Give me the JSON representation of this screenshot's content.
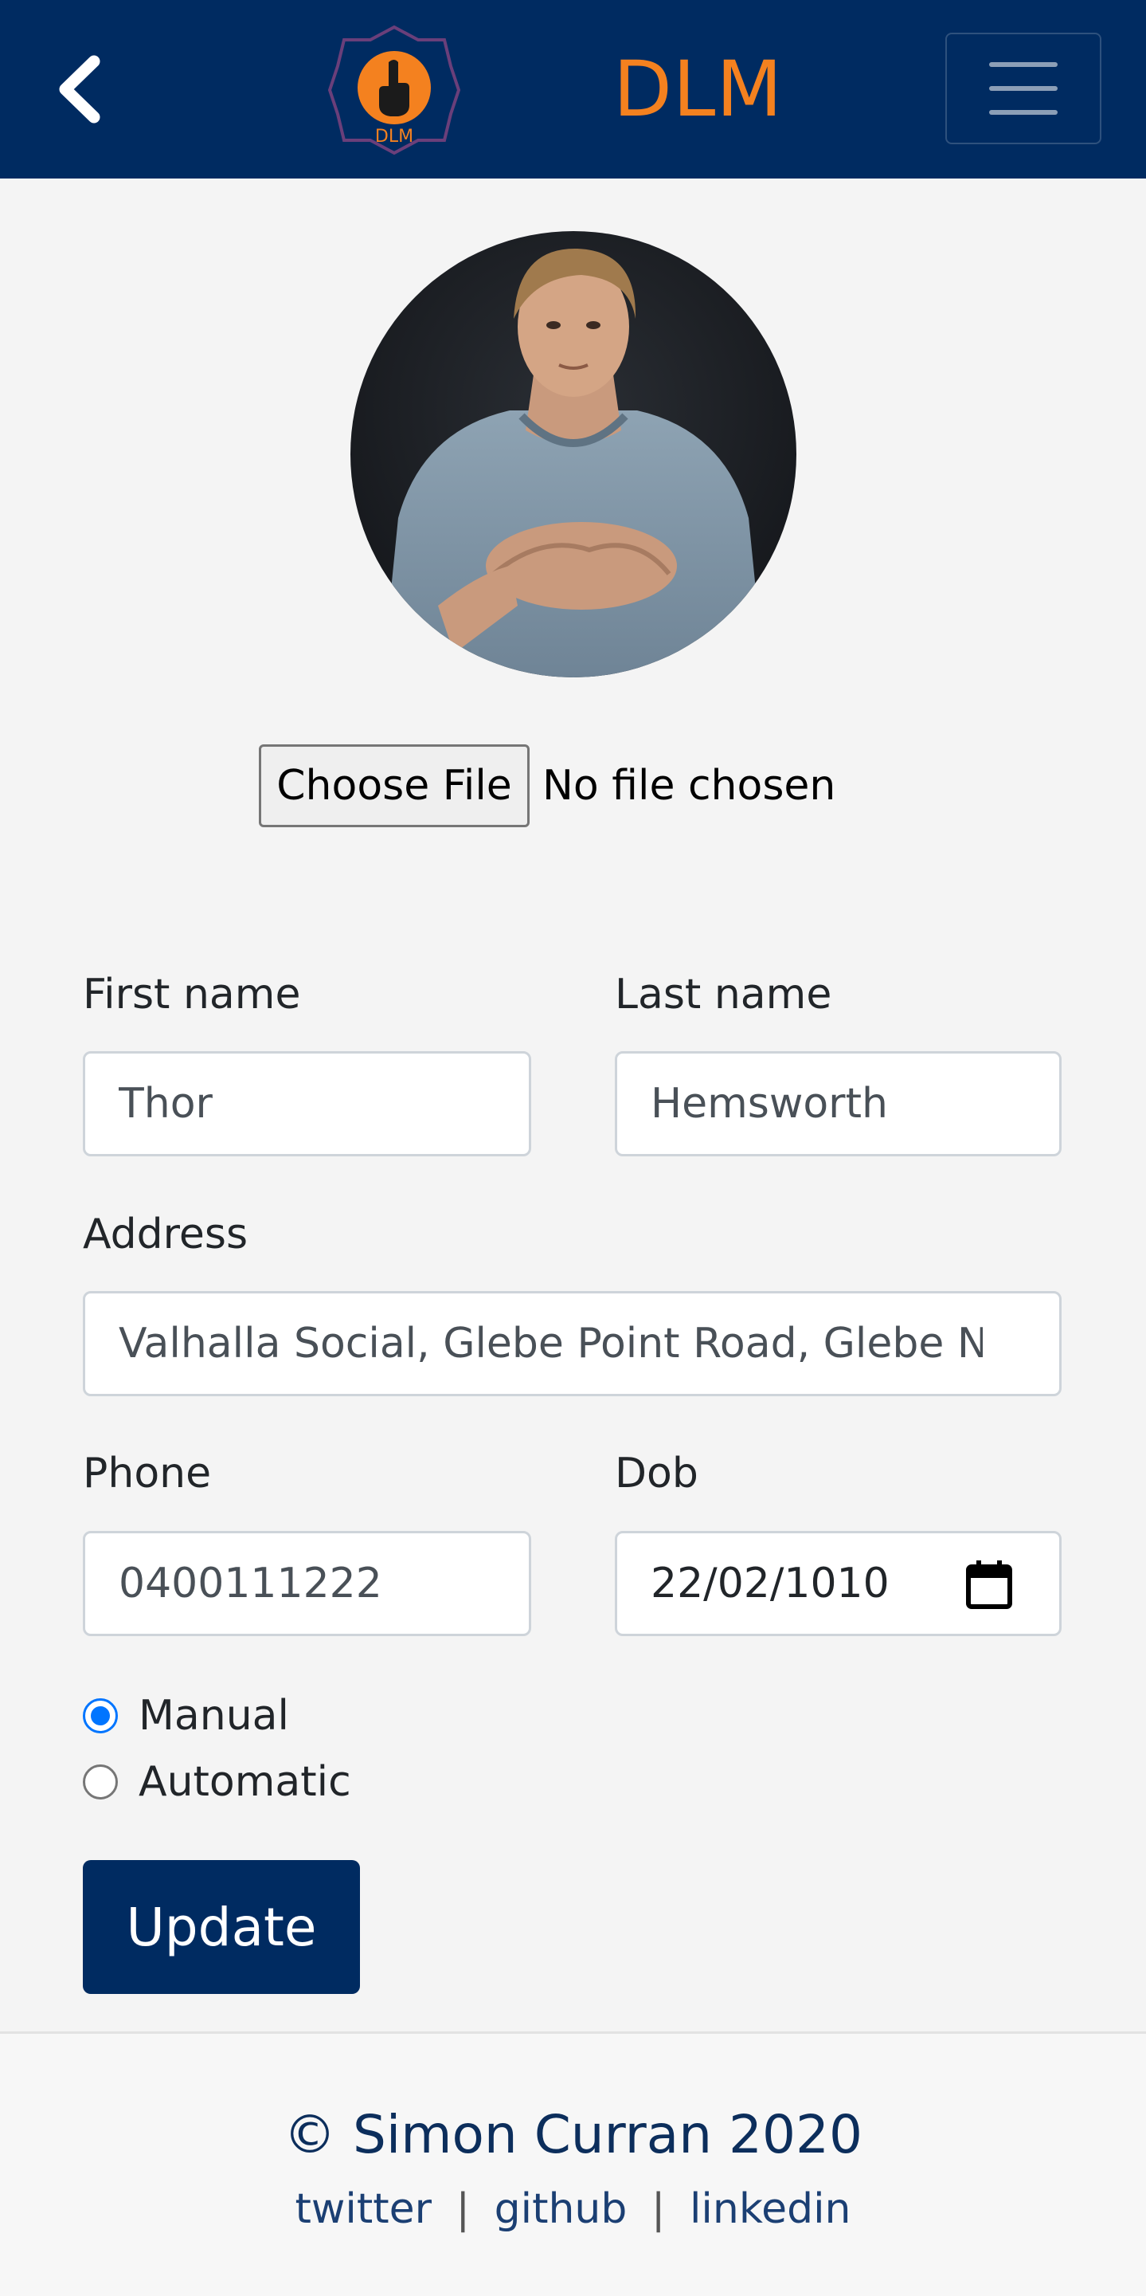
{
  "navbar": {
    "brand": "DLM",
    "logo_text": "DLM",
    "back_icon": "chevron-left-icon",
    "menu_icon": "hamburger-menu-icon",
    "background_color": "#002b61",
    "brand_color": "#f4811f"
  },
  "profile": {
    "avatar_alt": "profile-photo"
  },
  "file_input": {
    "button_label": "Choose File",
    "status_text": "No file chosen"
  },
  "form": {
    "first_name": {
      "label": "First name",
      "value": "Thor"
    },
    "last_name": {
      "label": "Last name",
      "value": "Hemsworth"
    },
    "address": {
      "label": "Address",
      "value": "Valhalla Social, Glebe Point Road, Glebe NSW"
    },
    "phone": {
      "label": "Phone",
      "value": "0400111222"
    },
    "dob": {
      "label": "Dob",
      "value": "22/02/1010"
    },
    "transmission": {
      "options": [
        {
          "label": "Manual",
          "checked": true
        },
        {
          "label": "Automatic",
          "checked": false
        }
      ]
    },
    "submit_label": "Update"
  },
  "footer": {
    "copyright": "© Simon Curran 2020",
    "links": [
      "twitter",
      "github",
      "linkedin"
    ],
    "separator": "|"
  }
}
